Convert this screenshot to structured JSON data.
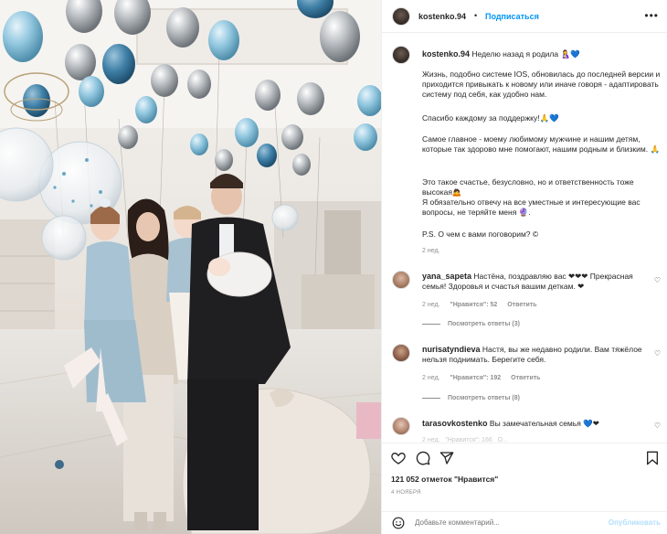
{
  "post": {
    "username": "kostenko.94",
    "follow_label": "Подписаться",
    "separator": "•",
    "more_label": "•••"
  },
  "caption": {
    "username": "kostenko.94",
    "line1": "Неделю назад я родила 🤱💙",
    "p1": "Жизнь, подобно системе IOS, обновилась до последней версии и приходится привыкать к новому или иначе говоря - адаптировать систему под себя, как удобно нам.",
    "p2": "Спасибо каждому за поддержку!🙏💙",
    "p3": "Самое главное - моему любимому мужчине и нашим детям, которые так здорово мне помогают, нашим родным и близким. 🙏",
    "p4a": "Это такое счастье, безусловно, но и ответственность тоже высокая🙇",
    "p4b": "Я обязательно отвечу на все уместные и интересующие вас вопросы, не теряйте меня 🔮.",
    "p5": "P.S. О чем с вами поговорим? ©",
    "time": "2 нед."
  },
  "comments": [
    {
      "username": "yana_sapeta",
      "text": "Настёна, поздравляю вас ❤❤❤ Прекрасная семья! Здоровья и счастья вашим деткам. ❤",
      "time": "2 нед.",
      "likes": "\"Нравится\": 52",
      "reply": "Ответить",
      "view_replies": "Посмотреть ответы (3)"
    },
    {
      "username": "nurisatyndieva",
      "text": "Настя, вы же недавно родили. Вам тяжёлое нельзя поднимать. Берегите себя.",
      "time": "2 нед.",
      "likes": "\"Нравится\": 192",
      "reply": "Ответить",
      "view_replies": "Посмотреть ответы (8)"
    },
    {
      "username": "tarasovkostenko",
      "text": "Вы замечательная семья 💙❤",
      "partial_meta": "2 нед.   \"Нравится\": 166   О..."
    }
  ],
  "actions": {
    "like_icon": "heart-icon",
    "comment_icon": "comment-icon",
    "share_icon": "paper-plane-icon",
    "save_icon": "bookmark-icon",
    "likes_text": "121 052 отметок \"Нравится\"",
    "date_text": "4 НОЯБРЯ"
  },
  "add_comment": {
    "emoji_icon": "smiley-icon",
    "placeholder": "Добавьте комментарий...",
    "publish_label": "Опубликовать"
  },
  "colors": {
    "link": "#0095f6",
    "secondary": "#8e8e8e",
    "heart_red": "#ed4956",
    "heart_blue": "#3b82c4",
    "publish_disabled": "#b2dffc"
  }
}
